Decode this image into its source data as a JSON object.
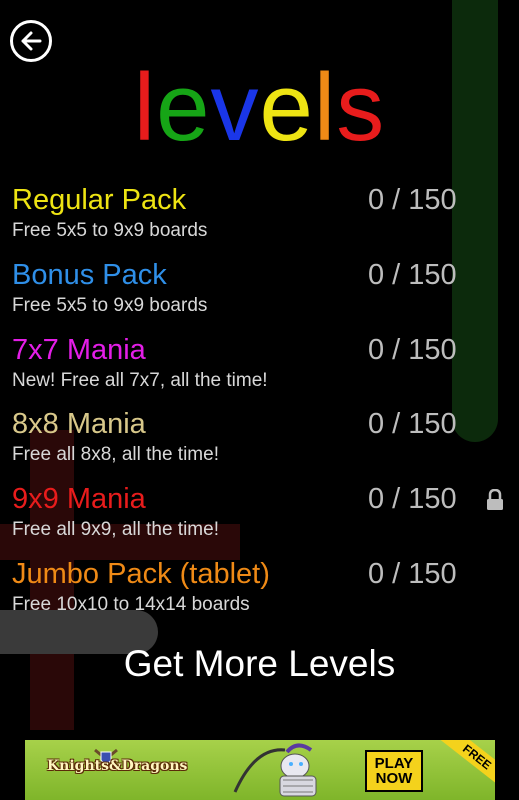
{
  "title": {
    "letters": [
      {
        "char": "l",
        "color": "#e81c1c"
      },
      {
        "char": "e",
        "color": "#16a516"
      },
      {
        "char": "v",
        "color": "#1a36e8"
      },
      {
        "char": "e",
        "color": "#eee413"
      },
      {
        "char": "l",
        "color": "#ef8a16"
      },
      {
        "char": "s",
        "color": "#e81c1c"
      }
    ]
  },
  "back_icon": "back-arrow-icon",
  "packs": [
    {
      "name": "Regular Pack",
      "desc": "Free 5x5 to 9x9 boards",
      "progress": "0 / 150",
      "color": "#eee413",
      "locked": false
    },
    {
      "name": "Bonus Pack",
      "desc": "Free 5x5 to 9x9 boards",
      "progress": "0 / 150",
      "color": "#2f8fe8",
      "locked": false
    },
    {
      "name": "7x7 Mania",
      "desc": "New! Free all 7x7, all the time!",
      "progress": "0 / 150",
      "color": "#e41ee8",
      "locked": false
    },
    {
      "name": "8x8 Mania",
      "desc": "Free all 8x8, all the time!",
      "progress": "0 / 150",
      "color": "#d8c88a",
      "locked": false
    },
    {
      "name": "9x9 Mania",
      "desc": "Free all 9x9, all the time!",
      "progress": "0 / 150",
      "color": "#e81c1c",
      "locked": true
    },
    {
      "name": "Jumbo Pack (tablet)",
      "desc": "Free 10x10 to 14x14 boards",
      "progress": "0 / 150",
      "color": "#ef8a16",
      "locked": false
    }
  ],
  "get_more": "Get More Levels",
  "ad": {
    "logo": "Knights&Dragons",
    "play_line1": "PLAY",
    "play_line2": "NOW",
    "corner": "FREE"
  }
}
